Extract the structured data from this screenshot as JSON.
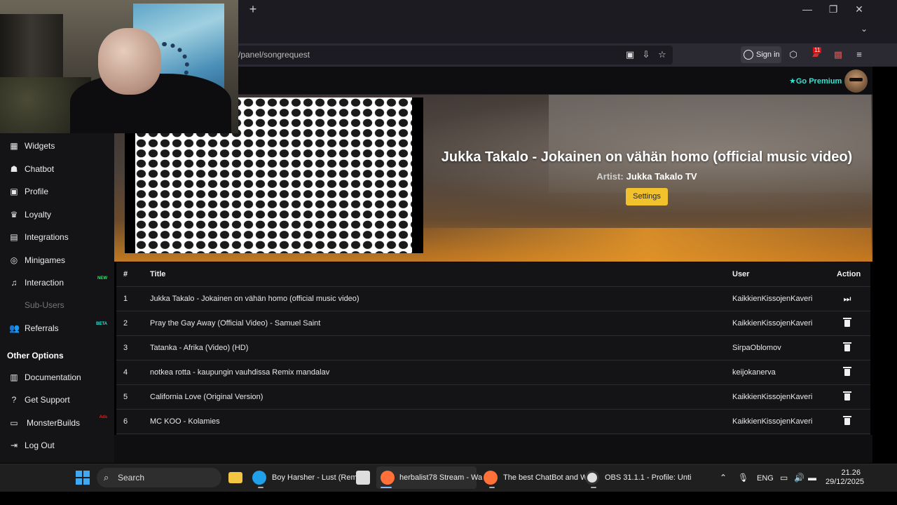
{
  "browser": {
    "url_text": "/panel/songrequest",
    "signin_label": "Sign in",
    "addon_badge": "11",
    "new_tab_symbol": "+",
    "min_symbol": "—",
    "max_symbol": "❐",
    "close_symbol": "✕",
    "tabs_dropdown_symbol": "⌄"
  },
  "header": {
    "premium_label": "Go Premium",
    "premium_color": "#2ee6d6"
  },
  "sidebar": {
    "items": [
      {
        "label": "Widgets",
        "icon": "widgets-icon",
        "glyph": "▦"
      },
      {
        "label": "Chatbot",
        "icon": "robot-icon",
        "glyph": "☗"
      },
      {
        "label": "Profile",
        "icon": "id-card-icon",
        "glyph": "▣"
      },
      {
        "label": "Loyalty",
        "icon": "trophy-icon",
        "glyph": "♛"
      },
      {
        "label": "Integrations",
        "icon": "integrations-icon",
        "glyph": "▤"
      },
      {
        "label": "Minigames",
        "icon": "gamepad-icon",
        "glyph": "◎"
      },
      {
        "label": "Interaction",
        "icon": "music-note-icon",
        "glyph": "♫",
        "badge": "NEW",
        "badge_color": "#2ee66b"
      },
      {
        "label": "Sub-Users",
        "icon": "sub-users-icon",
        "glyph": "",
        "disabled": true
      },
      {
        "label": "Referrals",
        "icon": "users-icon",
        "glyph": "👥",
        "badge": "BETA",
        "badge_color": "#2ee6d6"
      }
    ],
    "other_header": "Other Options",
    "other_items": [
      {
        "label": "Documentation",
        "icon": "book-icon",
        "glyph": "▥"
      },
      {
        "label": "Get Support",
        "icon": "question-icon",
        "glyph": "?"
      },
      {
        "label": "MonsterBuilds",
        "icon": "laptop-icon",
        "glyph": "▭",
        "badge": "Ads",
        "badge_color": "#d22"
      },
      {
        "label": "Log Out",
        "icon": "logout-icon",
        "glyph": "⇥"
      }
    ]
  },
  "now_playing": {
    "title": "Jukka Takalo - Jokainen on vähän homo (official music video)",
    "artist_label": "Artist:",
    "artist": "Jukka Takalo TV",
    "settings_label": "Settings",
    "accent": "#f2c12e"
  },
  "queue": {
    "headers": {
      "num": "#",
      "title": "Title",
      "user": "User",
      "action": "Action"
    },
    "rows": [
      {
        "num": "1",
        "title": "Jukka Takalo - Jokainen on vähän homo (official music video)",
        "user": "KaikkienKissojenKaveri",
        "action": "play-next-icon"
      },
      {
        "num": "2",
        "title": "Pray the Gay Away (Official Video) - Samuel Saint",
        "user": "KaikkienKissojenKaveri",
        "action": "trash-icon"
      },
      {
        "num": "3",
        "title": "Tatanka - Afrika (Video) (HD)",
        "user": "SirpaOblomov",
        "action": "trash-icon"
      },
      {
        "num": "4",
        "title": "notkea rotta - kaupungin vauhdissa Remix mandalav",
        "user": "keijokanerva",
        "action": "trash-icon"
      },
      {
        "num": "5",
        "title": "California Love (Original Version)",
        "user": "KaikkienKissojenKaveri",
        "action": "trash-icon"
      },
      {
        "num": "6",
        "title": "MC KOO - Kolamies",
        "user": "KaikkienKissojenKaveri",
        "action": "trash-icon"
      }
    ]
  },
  "taskbar": {
    "search_label": "Search",
    "apps": [
      {
        "label": "Boy Harsher - Lust (Rem",
        "icon": "edge-icon",
        "color": "#1fa0e8"
      },
      {
        "label": "herbalist78 Stream - Wa",
        "icon": "firefox-icon",
        "color": "#ff7139",
        "active": true
      },
      {
        "label": "The best ChatBot and W",
        "icon": "firefox-icon",
        "color": "#ff7139"
      },
      {
        "label": "OBS 31.1.1 - Profile: Unti",
        "icon": "obs-icon",
        "color": "#e0e0e0"
      }
    ],
    "language": "ENG",
    "time": "21.26",
    "date": "29/12/2025"
  }
}
